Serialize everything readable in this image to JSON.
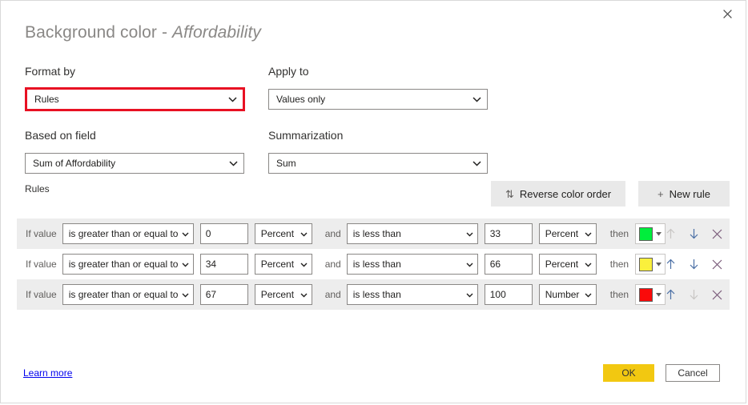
{
  "dialog": {
    "title_main": "Background color - ",
    "title_field": "Affordability",
    "close_label": "Close"
  },
  "format_by": {
    "label": "Format by",
    "value": "Rules"
  },
  "apply_to": {
    "label": "Apply to",
    "value": "Values only"
  },
  "based_on_field": {
    "label": "Based on field",
    "value": "Sum of Affordability"
  },
  "summarization": {
    "label": "Summarization",
    "value": "Sum"
  },
  "rules_section": {
    "caption": "Rules",
    "reverse_button": "Reverse color order",
    "reverse_icon": "sort-arrows-icon",
    "new_rule_button": "New rule",
    "new_rule_icon": "plus-icon"
  },
  "rule_labels": {
    "if_value": "If value",
    "and": "and",
    "then": "then"
  },
  "rules": [
    {
      "min_operator": "is greater than or equal to",
      "min_value": "0",
      "min_unit": "Percent",
      "max_operator": "is less than",
      "max_value": "33",
      "max_unit": "Percent",
      "color": "#00ee3c",
      "move_up_enabled": false,
      "move_down_enabled": true
    },
    {
      "min_operator": "is greater than or equal to",
      "min_value": "34",
      "min_unit": "Percent",
      "max_operator": "is less than",
      "max_value": "66",
      "max_unit": "Percent",
      "color": "#faf03c",
      "move_up_enabled": true,
      "move_down_enabled": true
    },
    {
      "min_operator": "is greater than or equal to",
      "min_value": "67",
      "min_unit": "Percent",
      "max_operator": "is less than",
      "max_value": "100",
      "max_unit": "Number",
      "color": "#fa0a0a",
      "move_up_enabled": true,
      "move_down_enabled": false
    }
  ],
  "footer": {
    "learn_more": "Learn more",
    "ok": "OK",
    "cancel": "Cancel"
  },
  "colors": {
    "accent_ok": "#f2c811",
    "highlight_border": "#e81123",
    "link": "#0000ee"
  }
}
